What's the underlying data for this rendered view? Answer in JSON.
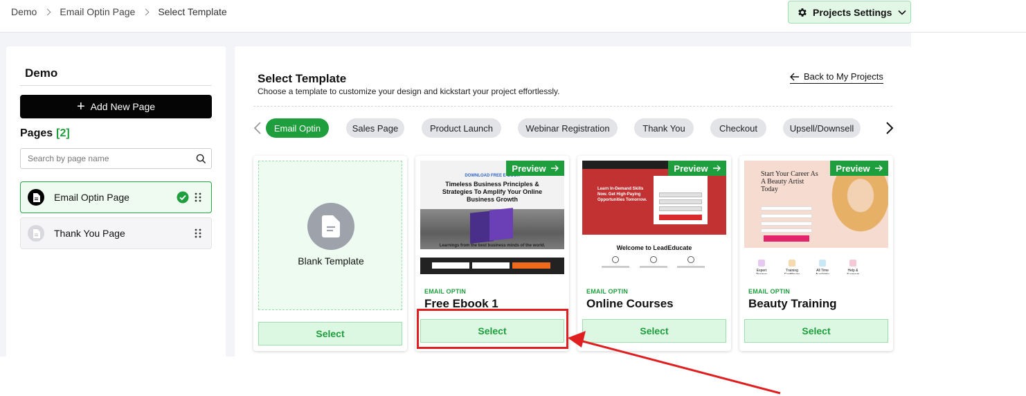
{
  "breadcrumb": [
    "Demo",
    "Email Optin Page",
    "Select Template"
  ],
  "project_settings": {
    "label": "Projects Settings"
  },
  "sidebar": {
    "title": "Demo",
    "add_page_label": "Add New Page",
    "pages_label": "Pages",
    "pages_count": "[2]",
    "search_placeholder": "Search by page name",
    "pages": [
      {
        "label": "Email Optin Page",
        "active": true
      },
      {
        "label": "Thank You Page",
        "active": false
      }
    ]
  },
  "main": {
    "title": "Select Template",
    "subtitle": "Choose a template to customize your design and kickstart your project effortlessly.",
    "back_label": "Back to My Projects",
    "categories": [
      "Email Optin",
      "Sales Page",
      "Product Launch",
      "Webinar Registration",
      "Thank You",
      "Checkout",
      "Upsell/Downsell"
    ],
    "active_category": "Email Optin",
    "blank_template_label": "Blank Template",
    "preview_label": "Preview",
    "select_label": "Select",
    "templates": [
      {
        "tag": "EMAIL OPTIN",
        "name": "Free Ebook 1",
        "thumb_small": "DOWNLOAD FREE E-BOOK",
        "thumb_headline": "Timeless Business Principles & Strategies To Amplify Your Online Business Growth",
        "thumb_quote": "Learnings from the best business minds of the world."
      },
      {
        "tag": "EMAIL OPTIN",
        "name": "Online Courses",
        "thumb_hero": "Learn In-Demand Skills Now. Get High-Paying Opportunities Tomorrow.",
        "thumb_welcome": "Welcome to LeadEducate"
      },
      {
        "tag": "EMAIL OPTIN",
        "name": "Beauty Training",
        "thumb_headline": "Start Your Career As A Beauty Artist Today",
        "thumb_features": [
          "Expert Trainer",
          "Training Certificate",
          "All Time Available",
          "Help & Support"
        ]
      }
    ]
  },
  "colors": {
    "accent": "#1e9e3c",
    "highlight": "#e02020"
  }
}
